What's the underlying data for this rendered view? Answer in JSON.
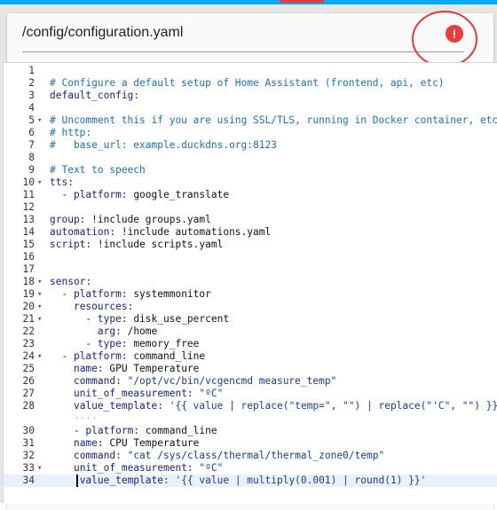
{
  "file_path": "/config/configuration.yaml",
  "error_badge": "!",
  "colors": {
    "accent": "#03a9f4",
    "error": "#ef3b3b",
    "comment": "#1f6fb0",
    "key": "#1a237e"
  },
  "editor": {
    "lines": [
      {
        "n": "1",
        "fold": "",
        "tokens": []
      },
      {
        "n": "2",
        "fold": "",
        "tokens": [
          {
            "c": "t-comment",
            "t": "# Configure a default setup of Home Assistant (frontend, api, etc)"
          }
        ]
      },
      {
        "n": "3",
        "fold": "",
        "tokens": [
          {
            "c": "t-key",
            "t": "default_config:"
          }
        ]
      },
      {
        "n": "4",
        "fold": "",
        "tokens": []
      },
      {
        "n": "5",
        "fold": "▾",
        "tokens": [
          {
            "c": "t-comment",
            "t": "# Uncomment this if you are using SSL/TLS, running in Docker container, etc."
          }
        ]
      },
      {
        "n": "6",
        "fold": "",
        "tokens": [
          {
            "c": "t-comment",
            "t": "# http:"
          }
        ]
      },
      {
        "n": "7",
        "fold": "",
        "tokens": [
          {
            "c": "t-comment",
            "t": "#   base_url: example.duckdns.org:8123"
          }
        ]
      },
      {
        "n": "8",
        "fold": "",
        "tokens": []
      },
      {
        "n": "9",
        "fold": "",
        "tokens": [
          {
            "c": "t-comment",
            "t": "# Text to speech"
          }
        ]
      },
      {
        "n": "10",
        "fold": "▾",
        "tokens": [
          {
            "c": "t-key",
            "t": "tts:"
          }
        ]
      },
      {
        "n": "11",
        "fold": "",
        "tokens": [
          {
            "c": "t-val",
            "t": "  "
          },
          {
            "c": "t-dash",
            "t": "- platform: "
          },
          {
            "c": "t-val",
            "t": "google_translate"
          }
        ]
      },
      {
        "n": "12",
        "fold": "",
        "tokens": []
      },
      {
        "n": "13",
        "fold": "",
        "tokens": [
          {
            "c": "t-key",
            "t": "group: "
          },
          {
            "c": "t-val",
            "t": "!include groups.yaml"
          }
        ]
      },
      {
        "n": "14",
        "fold": "",
        "tokens": [
          {
            "c": "t-key",
            "t": "automation: "
          },
          {
            "c": "t-val",
            "t": "!include automations.yaml"
          }
        ]
      },
      {
        "n": "15",
        "fold": "",
        "tokens": [
          {
            "c": "t-key",
            "t": "script: "
          },
          {
            "c": "t-val",
            "t": "!include scripts.yaml"
          }
        ]
      },
      {
        "n": "16",
        "fold": "",
        "tokens": []
      },
      {
        "n": "17",
        "fold": "",
        "tokens": []
      },
      {
        "n": "18",
        "fold": "▾",
        "tokens": [
          {
            "c": "t-key",
            "t": "sensor:"
          }
        ]
      },
      {
        "n": "19",
        "fold": "▾",
        "tokens": [
          {
            "c": "t-val",
            "t": "  "
          },
          {
            "c": "t-dash",
            "t": "- platform: "
          },
          {
            "c": "t-val",
            "t": "systemmonitor"
          }
        ]
      },
      {
        "n": "20",
        "fold": "▾",
        "tokens": [
          {
            "c": "t-val",
            "t": "    "
          },
          {
            "c": "t-key",
            "t": "resources:"
          }
        ]
      },
      {
        "n": "21",
        "fold": "▾",
        "tokens": [
          {
            "c": "t-val",
            "t": "      "
          },
          {
            "c": "t-dash",
            "t": "- type: "
          },
          {
            "c": "t-val",
            "t": "disk_use_percent"
          }
        ]
      },
      {
        "n": "22",
        "fold": "",
        "tokens": [
          {
            "c": "t-val",
            "t": "        "
          },
          {
            "c": "t-key",
            "t": "arg: "
          },
          {
            "c": "t-val",
            "t": "/home"
          }
        ]
      },
      {
        "n": "23",
        "fold": "",
        "tokens": [
          {
            "c": "t-val",
            "t": "      "
          },
          {
            "c": "t-dash",
            "t": "- type: "
          },
          {
            "c": "t-val",
            "t": "memory_free"
          }
        ]
      },
      {
        "n": "24",
        "fold": "▾",
        "tokens": [
          {
            "c": "t-val",
            "t": "  "
          },
          {
            "c": "t-dash",
            "t": "- platform: "
          },
          {
            "c": "t-val",
            "t": "command_line"
          }
        ]
      },
      {
        "n": "25",
        "fold": "",
        "tokens": [
          {
            "c": "t-val",
            "t": "    "
          },
          {
            "c": "t-key",
            "t": "name: "
          },
          {
            "c": "t-val",
            "t": "GPU Temperature"
          }
        ]
      },
      {
        "n": "26",
        "fold": "",
        "tokens": [
          {
            "c": "t-val",
            "t": "    "
          },
          {
            "c": "t-key",
            "t": "command: "
          },
          {
            "c": "t-str",
            "t": "\"/opt/vc/bin/vcgencmd measure_temp\""
          }
        ]
      },
      {
        "n": "27",
        "fold": "",
        "tokens": [
          {
            "c": "t-val",
            "t": "    "
          },
          {
            "c": "t-key",
            "t": "unit_of_measurement: "
          },
          {
            "c": "t-str",
            "t": "\"ºC\""
          }
        ]
      },
      {
        "n": "28",
        "fold": "",
        "tokens": [
          {
            "c": "t-val",
            "t": "    "
          },
          {
            "c": "t-key",
            "t": "value_template: "
          },
          {
            "c": "t-str",
            "t": "'{{ value | replace(\"temp=\", \"\") | replace(\"'C\", \"\") }}'"
          }
        ]
      },
      {
        "n": "",
        "fold": "",
        "tokens": [
          {
            "c": "t-ws",
            "t": "    ····"
          }
        ]
      },
      {
        "n": "30",
        "fold": "",
        "tokens": [
          {
            "c": "t-val",
            "t": "    "
          },
          {
            "c": "t-dash",
            "t": "- platform: "
          },
          {
            "c": "t-val",
            "t": "command_line"
          }
        ]
      },
      {
        "n": "31",
        "fold": "",
        "tokens": [
          {
            "c": "t-val",
            "t": "    "
          },
          {
            "c": "t-key",
            "t": "name: "
          },
          {
            "c": "t-val",
            "t": "CPU Temperature"
          }
        ]
      },
      {
        "n": "32",
        "fold": "",
        "tokens": [
          {
            "c": "t-val",
            "t": "    "
          },
          {
            "c": "t-key",
            "t": "command: "
          },
          {
            "c": "t-str",
            "t": "\"cat /sys/class/thermal/thermal_zone0/temp\""
          }
        ]
      },
      {
        "n": "33",
        "fold": "▾",
        "tokens": [
          {
            "c": "t-val",
            "t": "    "
          },
          {
            "c": "t-key",
            "t": "unit_of_measurement: "
          },
          {
            "c": "t-str",
            "t": "\"ºC\""
          }
        ]
      },
      {
        "n": "34",
        "fold": "",
        "tokens": [
          {
            "c": "t-val",
            "t": "     "
          },
          {
            "c": "t-key",
            "t": "value_template: "
          },
          {
            "c": "t-str",
            "t": "'{{ value | multiply(0.001) | round(1) }}'"
          }
        ]
      }
    ],
    "active_line": 33
  }
}
